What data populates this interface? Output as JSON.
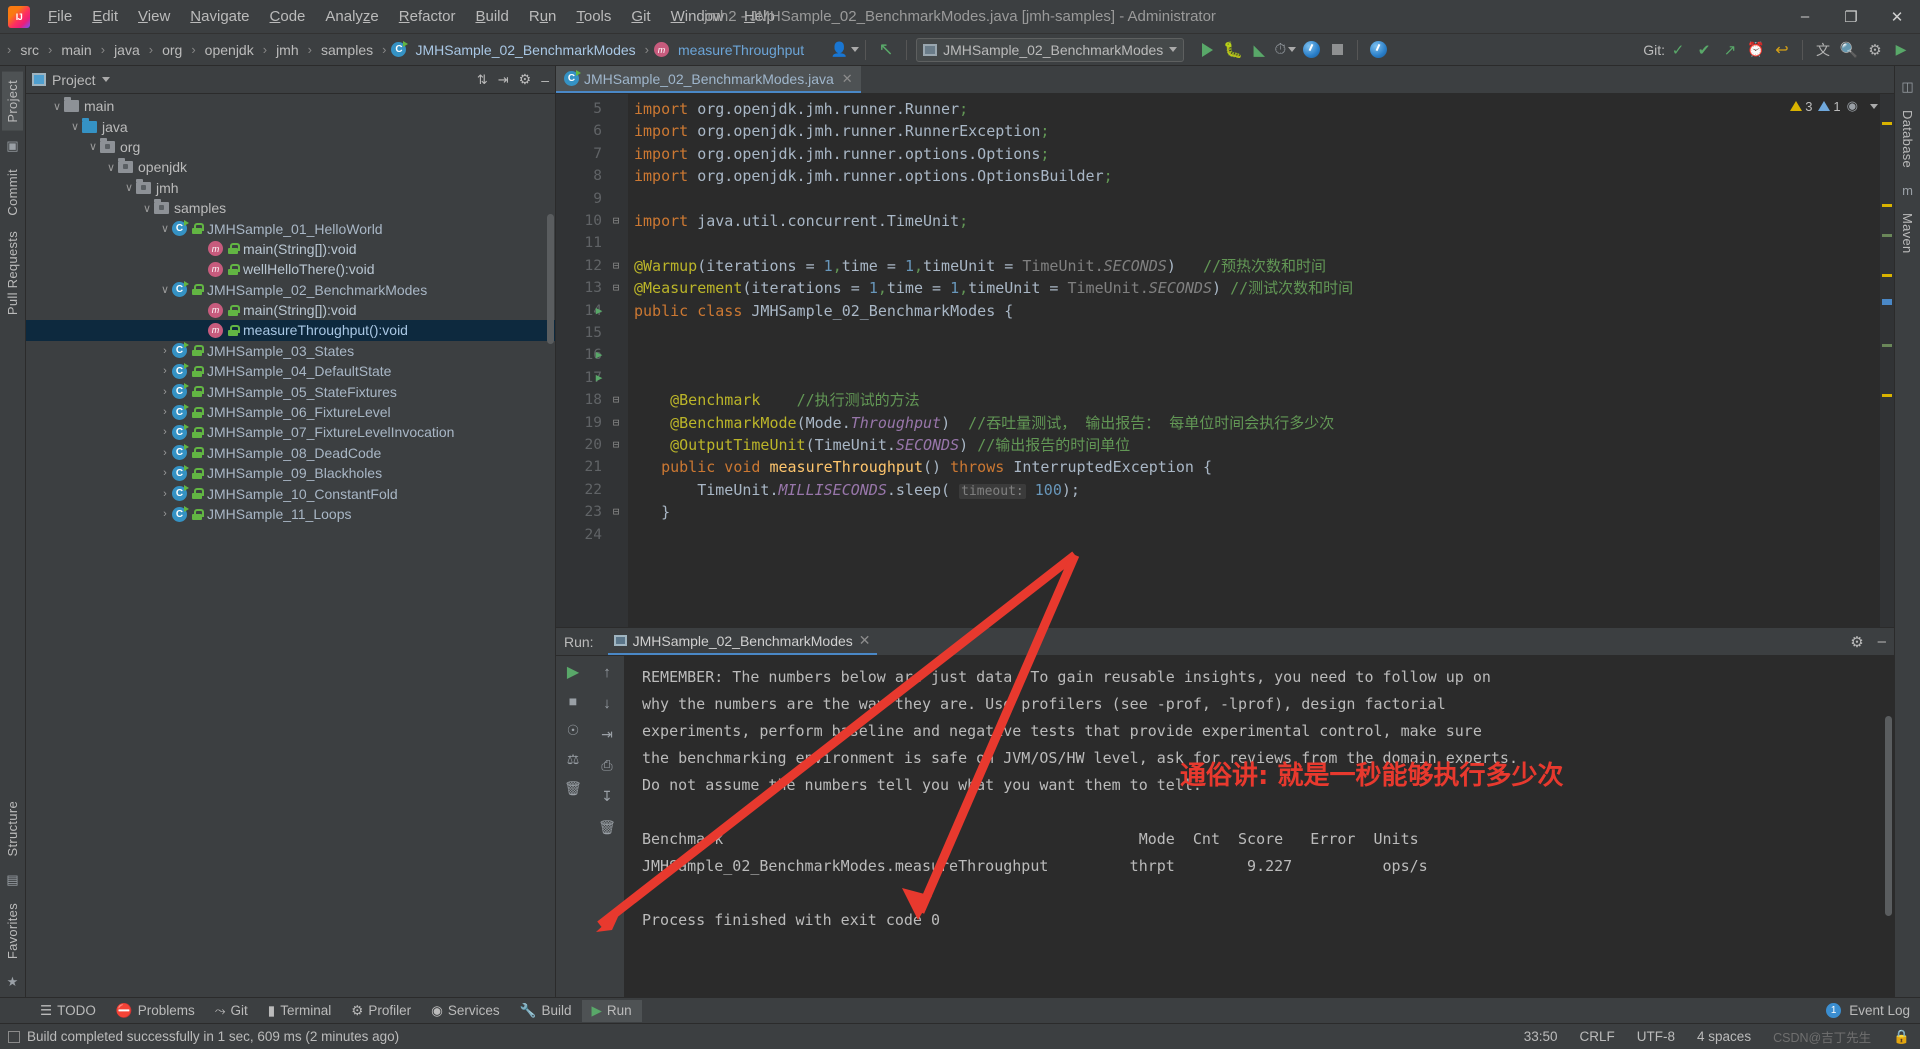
{
  "window": {
    "title": "jmh2 - JMHSample_02_BenchmarkModes.java [jmh-samples] - Administrator",
    "logo": "intellij-idea-logo",
    "minimize": "–",
    "maximize": "❐",
    "close": "✕"
  },
  "menubar": {
    "items": [
      {
        "label": "File"
      },
      {
        "label": "Edit"
      },
      {
        "label": "View"
      },
      {
        "label": "Navigate"
      },
      {
        "label": "Code"
      },
      {
        "label": "Analyze"
      },
      {
        "label": "Refactor"
      },
      {
        "label": "Build"
      },
      {
        "label": "Run"
      },
      {
        "label": "Tools"
      },
      {
        "label": "Git"
      },
      {
        "label": "Window"
      },
      {
        "label": "Help"
      }
    ]
  },
  "navbar": {
    "crumbs": [
      "src",
      "main",
      "java",
      "org",
      "openjdk",
      "jmh",
      "samples"
    ],
    "class_crumb": "JMHSample_02_BenchmarkModes",
    "method_crumb": "measureThroughput",
    "run_config": "JMHSample_02_BenchmarkModes",
    "git_label": "Git:",
    "separator": "›"
  },
  "left_rail": {
    "tabs": [
      "Project",
      "Commit",
      "Pull Requests"
    ]
  },
  "right_rail": {
    "tabs": [
      "Database",
      "Maven"
    ]
  },
  "bottom_rail": {
    "tabs": [
      "Structure",
      "Favorites"
    ]
  },
  "project_panel": {
    "title": "Project",
    "tree": [
      {
        "indent": 3,
        "twist": "∨",
        "icon": "folder",
        "label": "main",
        "type": "folder",
        "selected": false
      },
      {
        "indent": 4,
        "twist": "∨",
        "icon": "folder-source",
        "label": "java",
        "type": "folder-blue",
        "selected": false
      },
      {
        "indent": 5,
        "twist": "∨",
        "icon": "folder-package",
        "label": "org",
        "type": "package",
        "selected": false
      },
      {
        "indent": 6,
        "twist": "∨",
        "icon": "folder-package",
        "label": "openjdk",
        "type": "package",
        "selected": false
      },
      {
        "indent": 7,
        "twist": "∨",
        "icon": "folder-package",
        "label": "jmh",
        "type": "package",
        "selected": false
      },
      {
        "indent": 8,
        "twist": "∨",
        "icon": "folder-package",
        "label": "samples",
        "type": "package",
        "selected": false
      },
      {
        "indent": 9,
        "twist": "∨",
        "icon": "java-class",
        "label": "JMHSample_01_HelloWorld",
        "type": "class",
        "selected": false
      },
      {
        "indent": 11,
        "twist": "",
        "icon": "java-method",
        "label": "main(String[]):void",
        "type": "method",
        "selected": false
      },
      {
        "indent": 11,
        "twist": "",
        "icon": "java-method",
        "label": "wellHelloThere():void",
        "type": "method",
        "selected": false
      },
      {
        "indent": 9,
        "twist": "∨",
        "icon": "java-class",
        "label": "JMHSample_02_BenchmarkModes",
        "type": "class",
        "selected": false
      },
      {
        "indent": 11,
        "twist": "",
        "icon": "java-method",
        "label": "main(String[]):void",
        "type": "method",
        "selected": false
      },
      {
        "indent": 11,
        "twist": "",
        "icon": "java-method",
        "label": "measureThroughput():void",
        "type": "method",
        "selected": true
      },
      {
        "indent": 9,
        "twist": "›",
        "icon": "java-class",
        "label": "JMHSample_03_States",
        "type": "class",
        "selected": false
      },
      {
        "indent": 9,
        "twist": "›",
        "icon": "java-class",
        "label": "JMHSample_04_DefaultState",
        "type": "class",
        "selected": false
      },
      {
        "indent": 9,
        "twist": "›",
        "icon": "java-class",
        "label": "JMHSample_05_StateFixtures",
        "type": "class",
        "selected": false
      },
      {
        "indent": 9,
        "twist": "›",
        "icon": "java-class",
        "label": "JMHSample_06_FixtureLevel",
        "type": "class",
        "selected": false
      },
      {
        "indent": 9,
        "twist": "›",
        "icon": "java-class",
        "label": "JMHSample_07_FixtureLevelInvocation",
        "type": "class",
        "selected": false
      },
      {
        "indent": 9,
        "twist": "›",
        "icon": "java-class",
        "label": "JMHSample_08_DeadCode",
        "type": "class",
        "selected": false
      },
      {
        "indent": 9,
        "twist": "›",
        "icon": "java-class",
        "label": "JMHSample_09_Blackholes",
        "type": "class",
        "selected": false
      },
      {
        "indent": 9,
        "twist": "›",
        "icon": "java-class",
        "label": "JMHSample_10_ConstantFold",
        "type": "class",
        "selected": false
      },
      {
        "indent": 9,
        "twist": "›",
        "icon": "java-class",
        "label": "JMHSample_11_Loops",
        "type": "class",
        "selected": false
      }
    ]
  },
  "editor": {
    "tab_label": "JMHSample_02_BenchmarkModes.java",
    "tab_close": "✕",
    "inspections": {
      "warnings": "3",
      "weak_warnings": "1"
    },
    "first_line_number": 5,
    "lines": [
      {
        "n": 5,
        "html": "<span class=\"k\">import</span> <span class=\"t\">org.openjdk.jmh.runner.Runner</span><span class=\"cm\">;</span>"
      },
      {
        "n": 6,
        "html": "<span class=\"k\">import</span> <span class=\"t\">org.openjdk.jmh.runner.RunnerException</span><span class=\"cm\">;</span>"
      },
      {
        "n": 7,
        "html": "<span class=\"k\">import</span> <span class=\"t\">org.openjdk.jmh.runner.options.Options</span><span class=\"cm\">;</span>"
      },
      {
        "n": 8,
        "html": "<span class=\"k\">import</span> <span class=\"t\">org.openjdk.jmh.runner.options.OptionsBuilder</span><span class=\"cm\">;</span>"
      },
      {
        "n": 9,
        "html": ""
      },
      {
        "n": 10,
        "html": "<span class=\"k\">import</span> <span class=\"t\">java.util.concurrent.TimeUnit</span><span class=\"cm\">;</span>"
      },
      {
        "n": 11,
        "html": ""
      },
      {
        "n": 12,
        "html": "<span class=\"an\">@Warmup</span><span class=\"t\">(iterations = </span><span class=\"n\">1</span><span class=\"cm\">,</span><span class=\"t\">time = </span><span class=\"n\">1</span><span class=\"cm\">,</span><span class=\"t\">timeUnit = </span><span class=\"gr\">TimeUnit.</span><span class=\"gr\" style=\"font-style:italic\">SECONDS</span><span class=\"t\">)</span>   <span class=\"cm\">//预热次数和时间</span>"
      },
      {
        "n": 13,
        "html": "<span class=\"an\">@Measurement</span><span class=\"t\">(iterations = </span><span class=\"n\">1</span><span class=\"cm\">,</span><span class=\"t\">time = </span><span class=\"n\">1</span><span class=\"cm\">,</span><span class=\"t\">timeUnit = </span><span class=\"gr\">TimeUnit.</span><span class=\"gr\" style=\"font-style:italic\">SECONDS</span><span class=\"t\">)</span> <span class=\"cm\">//测试次数和时间</span>"
      },
      {
        "n": 14,
        "html": "<span class=\"k\">public class</span> <span class=\"cls-name\">JMHSample_02_BenchmarkModes</span> <span class=\"t\">{</span>"
      },
      {
        "n": 15,
        "html": ""
      },
      {
        "n": 16,
        "html": ""
      },
      {
        "n": 17,
        "html": ""
      },
      {
        "n": 18,
        "html": "    <span class=\"an\">@Benchmark</span>    <span class=\"cm\">//执行测试的方法</span>"
      },
      {
        "n": 19,
        "html": "    <span class=\"an\">@BenchmarkMode</span><span class=\"t\">(Mode.</span><span class=\"st\">Throughput</span><span class=\"t\">)</span>  <span class=\"cm\">//吞吐量测试， 输出报告： 每单位时间会执行多少次</span>"
      },
      {
        "n": 20,
        "html": "    <span class=\"an\">@OutputTimeUnit</span><span class=\"t\">(TimeUnit.</span><span class=\"st\">SECONDS</span><span class=\"t\">)</span> <span class=\"cm\">//输出报告的时间单位</span>"
      },
      {
        "n": 21,
        "html": "   <span class=\"k\">public void</span> <span class=\"mth-name\">measureThroughput</span><span class=\"t\">() </span><span class=\"k\">throws</span> <span class=\"t\">InterruptedException {</span>"
      },
      {
        "n": 22,
        "html": "       <span class=\"t\">TimeUnit.</span><span class=\"st\">MILLISECONDS</span><span class=\"t\">.sleep(</span> <span class=\"hint\">timeout:</span> <span class=\"n\">100</span><span class=\"t\">);</span>"
      },
      {
        "n": 23,
        "html": "   <span class=\"t\">}</span>"
      },
      {
        "n": 24,
        "html": ""
      }
    ]
  },
  "run_panel": {
    "label": "Run:",
    "tab_label": "JMHSample_02_BenchmarkModes",
    "tab_close": "✕",
    "console_text": "REMEMBER: The numbers below are just data. To gain reusable insights, you need to follow up on\nwhy the numbers are the way they are. Use profilers (see -prof, -lprof), design factorial\nexperiments, perform baseline and negative tests that provide experimental control, make sure\nthe benchmarking environment is safe on JVM/OS/HW level, ask for reviews from the domain experts.\nDo not assume the numbers tell you what you want them to tell.\n\nBenchmark                                              Mode  Cnt  Score   Error  Units\nJMHSample_02_BenchmarkModes.measureThroughput         thrpt        9.227          ops/s\n\nProcess finished with exit code 0",
    "tools": [
      "run-icon",
      "stop-icon",
      "camera-icon",
      "print-icon",
      "trash-icon"
    ],
    "tools2": [
      "scroll-up-icon",
      "scroll-down-icon",
      "soft-wrap-icon",
      "print-icon",
      "clear-all-icon"
    ]
  },
  "annotation": {
    "note": "通俗讲: 就是一秒能够执行多少次",
    "color": "#e8392e"
  },
  "bottom_bar": {
    "items": [
      {
        "label": "TODO",
        "icon": "todo-icon",
        "selected": false
      },
      {
        "label": "Problems",
        "icon": "problems-icon",
        "selected": false
      },
      {
        "label": "Git",
        "icon": "git-icon",
        "selected": false
      },
      {
        "label": "Terminal",
        "icon": "terminal-icon",
        "selected": false
      },
      {
        "label": "Profiler",
        "icon": "profiler-icon",
        "selected": false
      },
      {
        "label": "Services",
        "icon": "services-icon",
        "selected": false
      },
      {
        "label": "Build",
        "icon": "build-icon",
        "selected": false
      },
      {
        "label": "Run",
        "icon": "run-icon",
        "selected": true
      }
    ],
    "event_log": "Event Log",
    "event_count": "1"
  },
  "status_bar": {
    "message": "Build completed successfully in 1 sec, 609 ms (2 minutes ago)",
    "caret": "33:50",
    "line_sep": "CRLF",
    "encoding": "UTF-8",
    "indent": "4 spaces",
    "watermark": "CSDN@吉丁先生"
  }
}
